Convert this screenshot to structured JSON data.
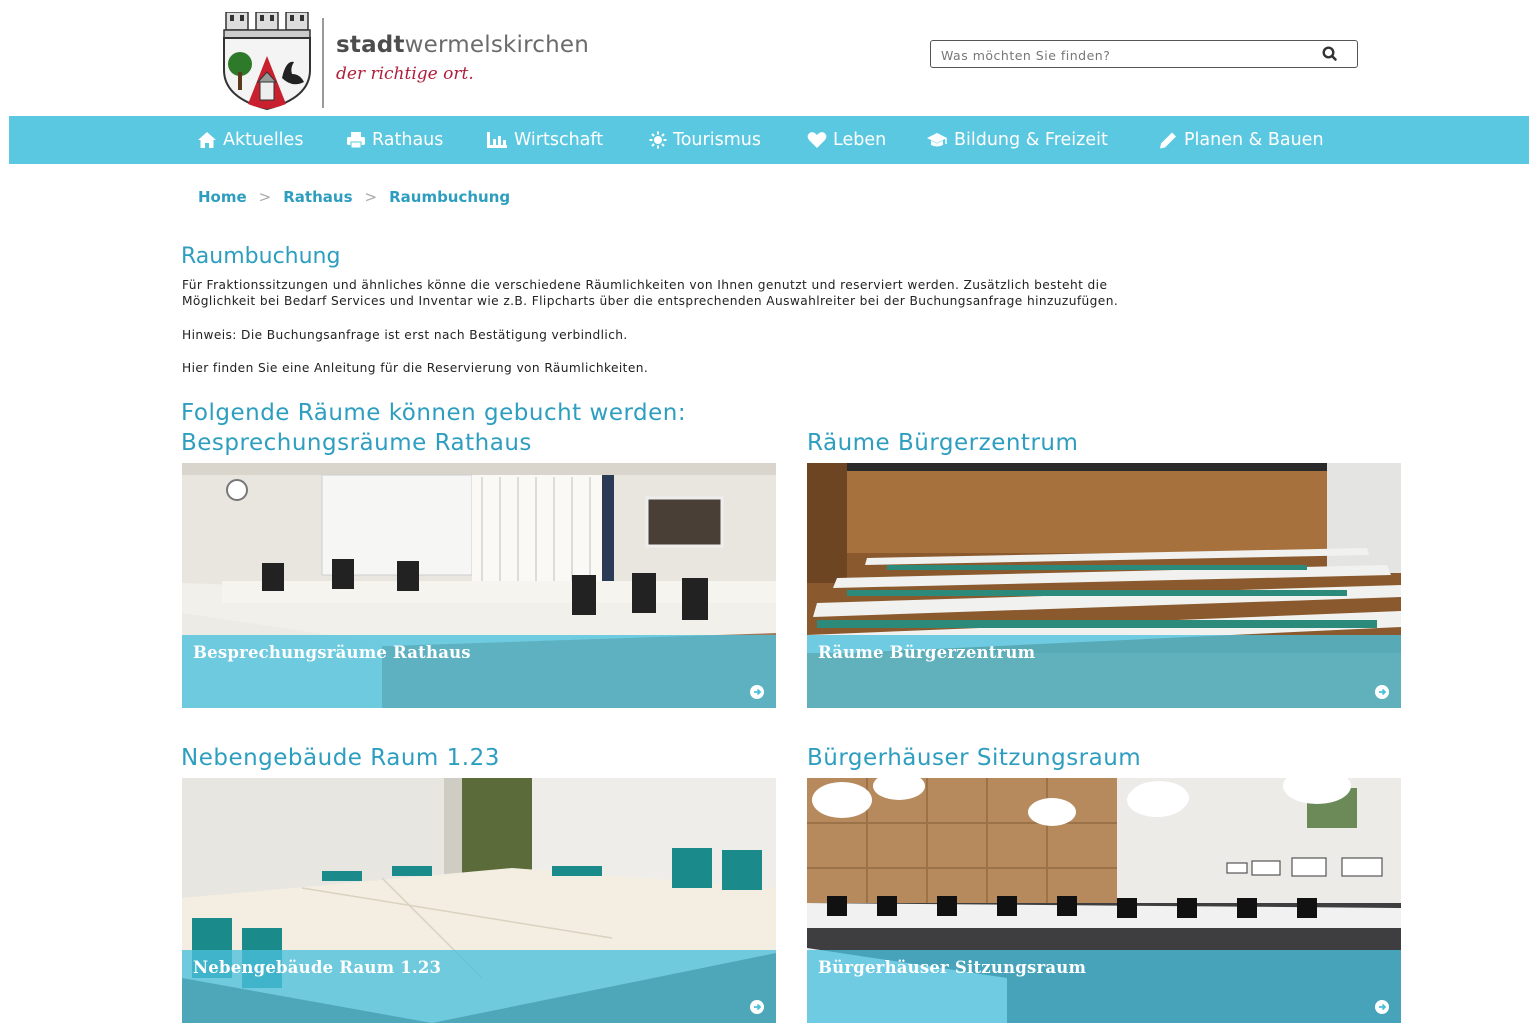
{
  "header": {
    "brand_bold": "stadt",
    "brand_rest": "wermelskirchen",
    "tagline": "der richtige ort.",
    "search_placeholder": "Was möchten Sie finden?"
  },
  "nav": [
    {
      "label": "Aktuelles",
      "icon": "home-icon"
    },
    {
      "label": "Rathaus",
      "icon": "printer-icon"
    },
    {
      "label": "Wirtschaft",
      "icon": "chart-icon"
    },
    {
      "label": "Tourismus",
      "icon": "sun-icon"
    },
    {
      "label": "Leben",
      "icon": "heart-icon"
    },
    {
      "label": "Bildung & Freizeit",
      "icon": "graduation-cap-icon"
    },
    {
      "label": "Planen & Bauen",
      "icon": "pencil-icon"
    }
  ],
  "breadcrumb": {
    "items": [
      "Home",
      "Rathaus",
      "Raumbuchung"
    ],
    "separator": ">"
  },
  "main": {
    "title": "Raumbuchung",
    "intro_line1": "Für Fraktionssitzungen und ähnliches könne die verschiedene Räumlichkeiten von Ihnen genutzt und reserviert werden. Zusätzlich besteht die",
    "intro_line2": "Möglichkeit bei Bedarf Services und Inventar wie z.B. Flipcharts über die entsprechenden Auswahlreiter bei der Buchungsanfrage hinzuzufügen.",
    "note": "Hinweis: Die Buchungsanfrage ist erst nach Bestätigung verbindlich.",
    "guide": "Hier finden Sie eine Anleitung für die Reservierung von Räumlichkeiten.",
    "rooms_heading": "Folgende Räume können gebucht werden:"
  },
  "rooms": [
    {
      "heading": "Besprechungsräume Rathaus",
      "overlay": "Besprechungsräume Rathaus"
    },
    {
      "heading": "Räume Bürgerzentrum",
      "overlay": "Räume Bürgerzentrum"
    },
    {
      "heading": "Nebengebäude Raum 1.23",
      "overlay": "Nebengebäude Raum 1.23"
    },
    {
      "heading": "Bürgerhäuser Sitzungsraum",
      "overlay": "Bürgerhäuser Sitzungsraum"
    }
  ],
  "colors": {
    "nav_bg": "#5ac8e0",
    "accent": "#2e9ec0",
    "tagline": "#b01e3a"
  }
}
